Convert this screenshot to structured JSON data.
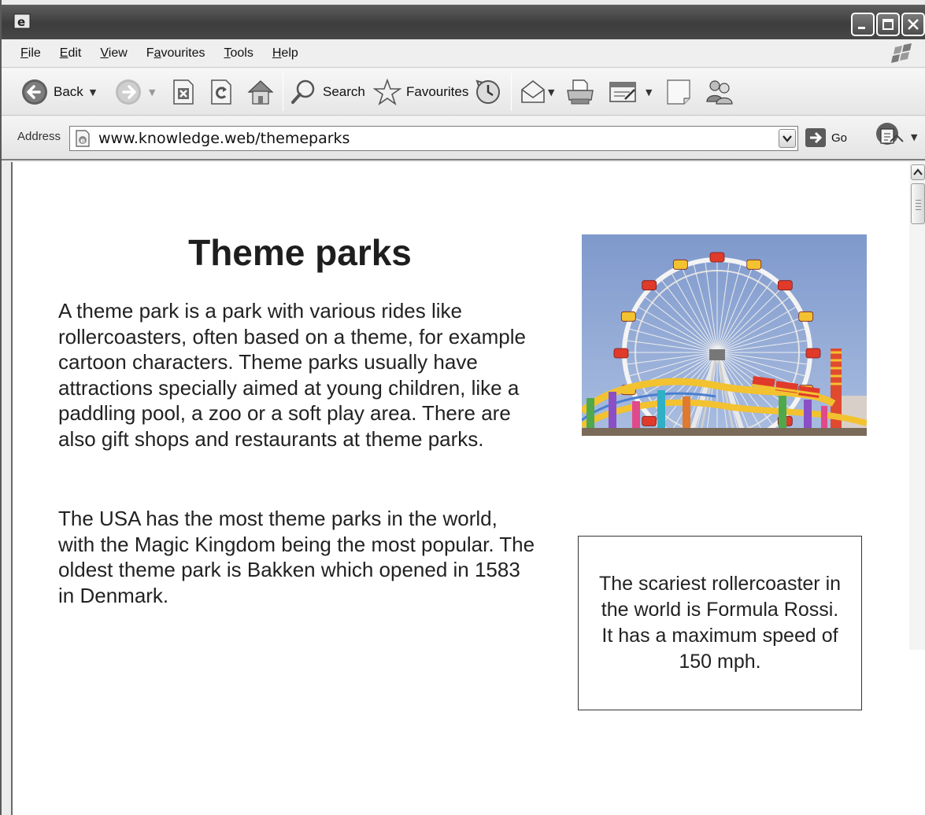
{
  "menu": {
    "items": [
      {
        "key": "F",
        "rest": "ile"
      },
      {
        "key": "E",
        "rest": "dit"
      },
      {
        "key": "V",
        "rest": "iew"
      },
      {
        "pre": "F",
        "key": "a",
        "rest": "vourites"
      },
      {
        "key": "T",
        "rest": "ools"
      },
      {
        "key": "H",
        "rest": "elp"
      }
    ]
  },
  "toolbar": {
    "back_label": "Back",
    "search_label": "Search",
    "favourites_label": "Favourites"
  },
  "address": {
    "label": "Address",
    "url": "www.knowledge.web/themeparks",
    "go_label": "Go"
  },
  "page": {
    "title": "Theme parks",
    "paragraph1": "A theme park is a park with various rides like rollercoasters, often based on a theme, for example cartoon characters. Theme parks usually have attractions specially aimed at young children, like a paddling pool, a zoo or a soft play area. There are also gift shops and restaurants at theme parks.",
    "paragraph2": "The USA has the most theme parks in the world, with the Magic Kingdom being the most popular. The oldest theme park is Bakken which opened in 1583 in Denmark.",
    "fact": "The scariest rollercoaster in the world is Formula Rossi. It has a maximum speed of 150 mph."
  },
  "colors": {
    "title_bar": "#474747",
    "sky": "#8fa7d4",
    "coaster_track": "#f2c230"
  }
}
